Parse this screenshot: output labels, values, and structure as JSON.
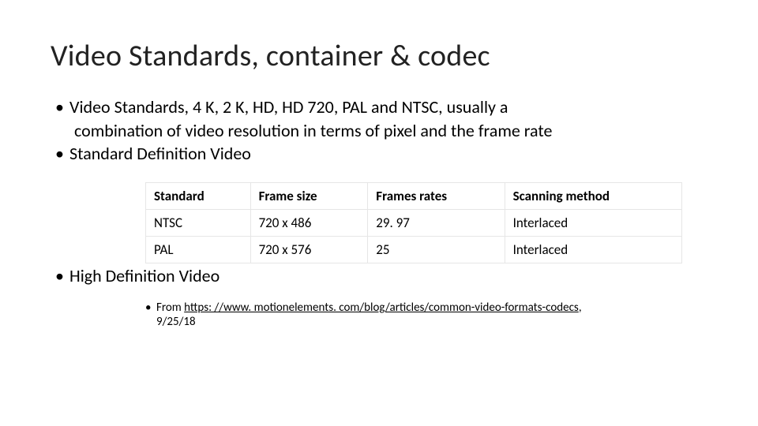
{
  "title": "Video Standards, container & codec",
  "bullets": {
    "b1_line1": "Video Standards, 4 K, 2 K, HD, HD 720, PAL and NTSC, usually a",
    "b1_line2": "combination of video resolution in terms of pixel and the frame rate",
    "b2": "Standard Definition Video",
    "b3": "High Definition Video"
  },
  "table": {
    "headers": [
      "Standard",
      "Frame size",
      "Frames rates",
      "Scanning method"
    ],
    "rows": [
      [
        "NTSC",
        "720 x 486",
        "29. 97",
        "Interlaced"
      ],
      [
        "PAL",
        "720 x 576",
        "25",
        "Interlaced"
      ]
    ]
  },
  "source": {
    "prefix": "From ",
    "link_text": "https: //www. motionelements. com/blog/articles/common-video-formats-codecs",
    "comma": ",",
    "date": "9/25/18"
  },
  "chart_data": {
    "type": "table",
    "title": "Standard Definition Video",
    "headers": [
      "Standard",
      "Frame size",
      "Frames rates",
      "Scanning method"
    ],
    "rows": [
      {
        "Standard": "NTSC",
        "Frame size": "720 x 486",
        "Frames rates": "29. 97",
        "Scanning method": "Interlaced"
      },
      {
        "Standard": "PAL",
        "Frame size": "720 x 576",
        "Frames rates": "25",
        "Scanning method": "Interlaced"
      }
    ]
  }
}
